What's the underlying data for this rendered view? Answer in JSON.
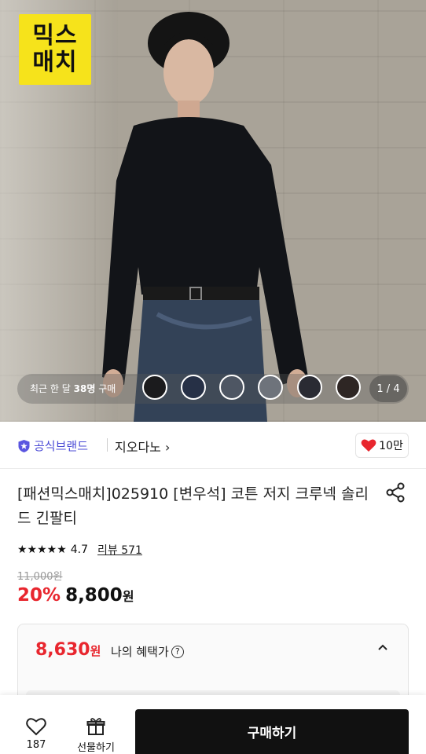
{
  "hero": {
    "logo_line1": "믹스",
    "logo_line2": "매치",
    "recent_buyers_prefix": "최근 한 달",
    "recent_buyers_count": "38명",
    "recent_buyers_suffix": "구매",
    "page_indicator": "1 / 4",
    "swatches": [
      "#1b1b1d",
      "#263046",
      "#4e5663",
      "#6e737b",
      "#2a2b33",
      "#2e2624"
    ]
  },
  "brand": {
    "badge_label": "공식브랜드",
    "name": "지오다노",
    "likes": "10만"
  },
  "product": {
    "title": "[패션믹스매치]025910 [변우석] 코튼 저지 크루넥 솔리드 긴팔티",
    "rating": "4.7",
    "rating_stars": 4.7,
    "review_label": "리뷰 571",
    "original_price": "11,000원",
    "discount": "20%",
    "sale_price": "8,800",
    "currency": "원"
  },
  "benefit": {
    "price": "8,630",
    "currency": "원",
    "label": "나의 혜택가"
  },
  "bottom_bar": {
    "wish_count": "187",
    "gift_label": "선물하기",
    "buy_label": "구매하기"
  },
  "colors": {
    "accent_red": "#e8262e",
    "brand_purple": "#4b4bd6",
    "logo_yellow": "#f6e31b"
  }
}
